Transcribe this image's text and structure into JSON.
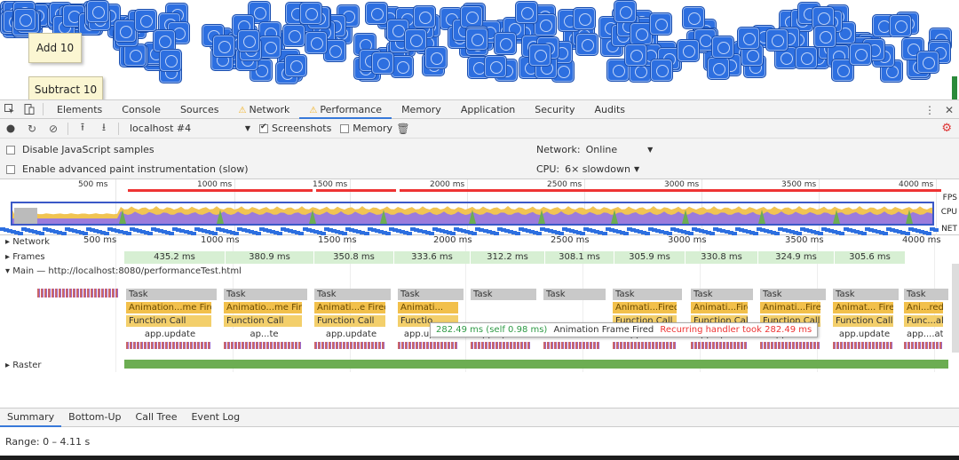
{
  "page": {
    "add_button": "Add 10",
    "subtract_button": "Subtract 10"
  },
  "devtools": {
    "tabs": [
      {
        "label": "Elements",
        "warn": false,
        "active": false
      },
      {
        "label": "Console",
        "warn": false,
        "active": false
      },
      {
        "label": "Sources",
        "warn": false,
        "active": false
      },
      {
        "label": "Network",
        "warn": true,
        "active": false
      },
      {
        "label": "Performance",
        "warn": true,
        "active": true
      },
      {
        "label": "Memory",
        "warn": false,
        "active": false
      },
      {
        "label": "Application",
        "warn": false,
        "active": false
      },
      {
        "label": "Security",
        "warn": false,
        "active": false
      },
      {
        "label": "Audits",
        "warn": false,
        "active": false
      }
    ],
    "toolbar": {
      "profile": "localhost #4",
      "screenshots_label": "Screenshots",
      "screenshots_checked": true,
      "memory_label": "Memory",
      "memory_checked": false
    },
    "settings": {
      "disable_js_samples": "Disable JavaScript samples",
      "adv_paint": "Enable advanced paint instrumentation (slow)",
      "network_label": "Network:",
      "network_value": "Online",
      "cpu_label": "CPU:",
      "cpu_value": "6× slowdown"
    },
    "overview": {
      "ticks": [
        "500 ms",
        "1000 ms",
        "1500 ms",
        "2000 ms",
        "2500 ms",
        "3000 ms",
        "3500 ms",
        "4000 ms"
      ],
      "fps_label": "FPS",
      "cpu_label": "CPU",
      "net_label": "NET"
    },
    "timeline": {
      "ticks": [
        "500 ms",
        "1000 ms",
        "1500 ms",
        "2000 ms",
        "2500 ms",
        "3000 ms",
        "3500 ms",
        "4000 ms"
      ],
      "network_label": "Network",
      "frames_label": "Frames",
      "main_label": "Main — http://localhost:8080/performanceTest.html",
      "raster_label": "Raster",
      "frames": [
        "435.2 ms",
        "380.9 ms",
        "350.8 ms",
        "333.6 ms",
        "312.2 ms",
        "308.1 ms",
        "305.9 ms",
        "330.8 ms",
        "324.9 ms",
        "305.6 ms"
      ],
      "task_label": "Task",
      "events": [
        {
          "anim": "Animation...me Fired",
          "func": "Function Call",
          "upd": "app.update"
        },
        {
          "anim": "Animatio...me Fired",
          "func": "Function Call",
          "upd": "ap...te"
        },
        {
          "anim": "Animati...e Fired",
          "func": "Function Call",
          "upd": "app.update"
        },
        {
          "anim": "Animati...",
          "func": "Functio",
          "upd": "app.update"
        },
        {
          "anim": "",
          "func": "",
          "upd": "app.update"
        },
        {
          "anim": "",
          "func": "",
          "upd": "a...e"
        },
        {
          "anim": "Animati...Fired",
          "func": "Function Call",
          "upd": "app....ate"
        },
        {
          "anim": "Animati...Fired",
          "func": "Function Call",
          "upd": "app.update"
        },
        {
          "anim": "Animati...Fired",
          "func": "Function Call",
          "upd": "app....ate"
        },
        {
          "anim": "Animat... Fired",
          "func": "Function Call",
          "upd": "app.update"
        },
        {
          "anim": "Ani...red",
          "func": "Func...all",
          "upd": "app....ate"
        }
      ],
      "extra_updates": [
        "app...te",
        "app....ate"
      ],
      "tooltip": {
        "time": "282.49 ms (self 0.98 ms)",
        "name": "Animation Frame Fired",
        "warning": "Recurring handler took 282.49 ms"
      }
    },
    "bottom_tabs": [
      "Summary",
      "Bottom-Up",
      "Call Tree",
      "Event Log"
    ],
    "range": "Range: 0 – 4.11 s"
  },
  "colors": {
    "accent": "#3879d9",
    "fps_red": "#e33",
    "cpu_purple": "#9b7bdc",
    "cpu_yellow": "#f1c453",
    "frame_green": "#d7efd3",
    "tooltip_green": "#2e9a45",
    "tooltip_red": "#e33"
  }
}
